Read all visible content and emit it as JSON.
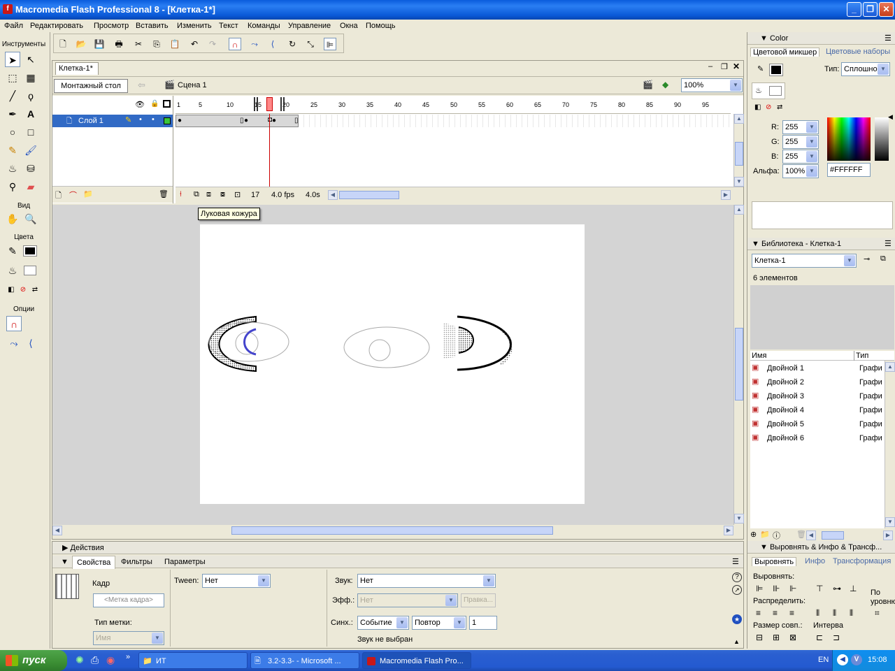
{
  "window": {
    "title": "Macromedia Flash Professional 8 - [Клетка-1*]",
    "app_icon_letter": "f",
    "buttons": [
      "_",
      "❐",
      "✕"
    ]
  },
  "menu": [
    "Файл",
    "Редактировать",
    "Просмотр",
    "Вставить",
    "Изменить",
    "Текст",
    "Команды",
    "Управление",
    "Окна",
    "Помощь"
  ],
  "tools": {
    "header": "Инструменты",
    "view_label": "Вид",
    "colors_label": "Цвета",
    "options_label": "Опции"
  },
  "document": {
    "tab": "Клетка-1*",
    "stage_button": "Монтажный стол",
    "scene": "Сцена 1",
    "zoom": "100%"
  },
  "timeline": {
    "ruler": [
      "1",
      "5",
      "10",
      "15",
      "20",
      "25",
      "30",
      "35",
      "40",
      "45",
      "50",
      "55",
      "60",
      "65",
      "70",
      "75",
      "80",
      "85",
      "90",
      "95"
    ],
    "layer_name": "Слой 1",
    "current_frame": "17",
    "fps": "4.0 fps",
    "time": "4.0s",
    "tooltip": "Луковая кожура"
  },
  "panels": {
    "actions": "Действия",
    "props_tabs": [
      "Свойства",
      "Фильтры",
      "Параметры"
    ],
    "frame_label": "Кадр",
    "frame_name_placeholder": "<Метка кадра>",
    "label_type": "Тип метки:",
    "label_type_value": "Имя",
    "tween_label": "Tween:",
    "tween_value": "Нет",
    "sound_label": "Звук:",
    "sound_value": "Нет",
    "effect_label": "Эфф.:",
    "effect_value": "Нет",
    "edit_button": "Правка...",
    "sync_label": "Синх.:",
    "sync_value": "Событие",
    "repeat_value": "Повтор",
    "repeat_count": "1",
    "no_sound": "Звук не выбран"
  },
  "color_panel": {
    "header": "Color",
    "tabs": [
      "Цветовой микшер",
      "Цветовые наборы"
    ],
    "type_label": "Тип:",
    "type_value": "Сплошной",
    "r_label": "R:",
    "r": "255",
    "g_label": "G:",
    "g": "255",
    "b_label": "B:",
    "b": "255",
    "alpha_label": "Альфа:",
    "alpha": "100%",
    "hex": "#FFFFFF"
  },
  "library": {
    "header": "Библиотека - Клетка-1",
    "doc": "Клетка-1",
    "count": "6 элементов",
    "col_name": "Имя",
    "col_type": "Тип",
    "items": [
      {
        "name": "Двойной 1",
        "type": "Графи"
      },
      {
        "name": "Двойной 2",
        "type": "Графи"
      },
      {
        "name": "Двойной 3",
        "type": "Графи"
      },
      {
        "name": "Двойной 4",
        "type": "Графи"
      },
      {
        "name": "Двойной 5",
        "type": "Графи"
      },
      {
        "name": "Двойной 6",
        "type": "Графи"
      }
    ]
  },
  "align_panel": {
    "header": "Выровнять & Инфо & Трансф...",
    "tabs": [
      "Выровнять",
      "Инфо",
      "Трансформация"
    ],
    "align_label": "Выровнять:",
    "distribute_label": "Распределить:",
    "match_label": "Размер совп.:",
    "space_label": "Интерва",
    "stage_label_1": "По",
    "stage_label_2": "уровню"
  },
  "taskbar": {
    "start": "пуск",
    "tasks": [
      "ИТ",
      "3.2-3.3- - Microsoft ...",
      "Macromedia Flash Pro..."
    ],
    "lang": "EN",
    "clock": "15:08"
  }
}
